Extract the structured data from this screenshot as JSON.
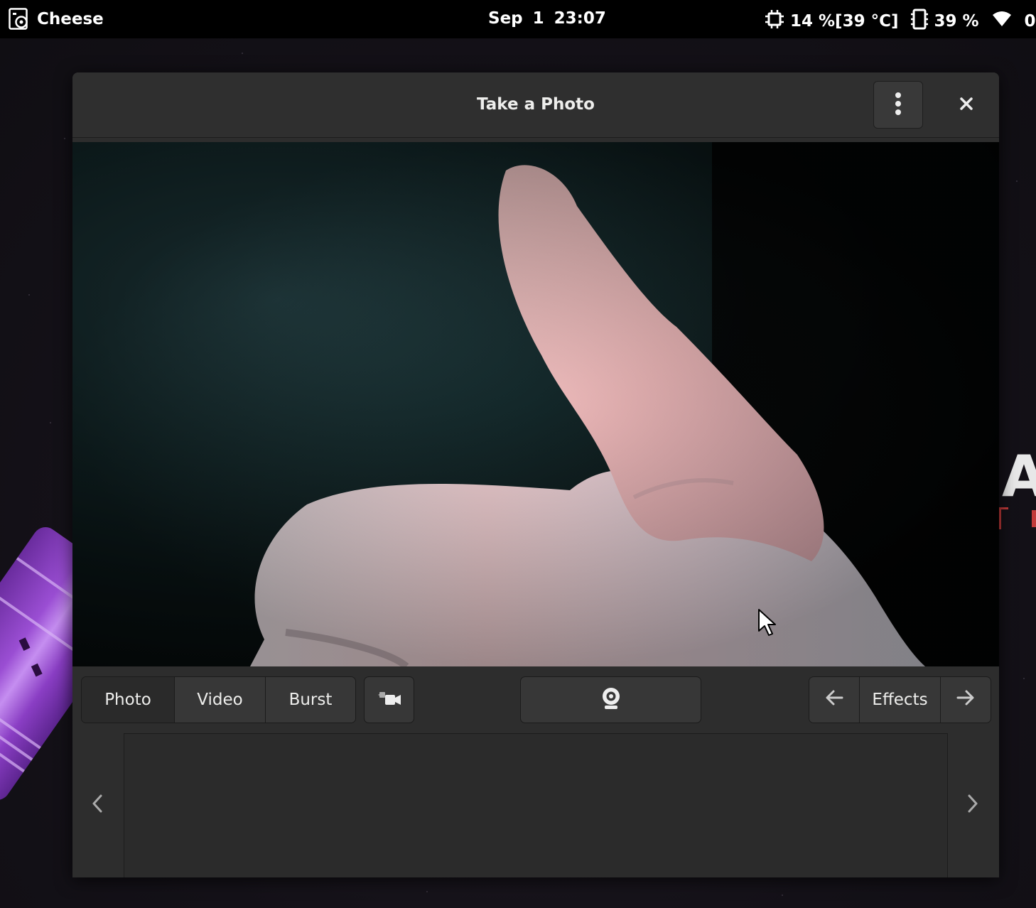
{
  "topbar": {
    "app_name": "Cheese",
    "date": "Sep 1",
    "time": "23:07",
    "cpu": "14 %[39 °C]",
    "memory": "39 %",
    "network": "0"
  },
  "window": {
    "title": "Take a Photo"
  },
  "modes": [
    {
      "label": "Photo",
      "active": true
    },
    {
      "label": "Video",
      "active": false
    },
    {
      "label": "Burst",
      "active": false
    }
  ],
  "effects": {
    "label": "Effects"
  },
  "icons": {
    "app": "cheese-icon",
    "cpu": "cpu-icon",
    "memory": "memory-icon",
    "wifi": "wifi-icon",
    "menu": "vertical-dots-icon",
    "close": "close-icon",
    "camera_switch": "camera-switch-icon",
    "shutter": "webcam-icon",
    "prev": "arrow-left-icon",
    "next": "arrow-right-icon",
    "scroll_left": "chevron-left-icon",
    "scroll_right": "chevron-right-icon"
  },
  "colors": {
    "topbar": "#000000",
    "window_bg": "#2d2d2d",
    "button_bg": "#373737",
    "text": "#eeeeec"
  }
}
